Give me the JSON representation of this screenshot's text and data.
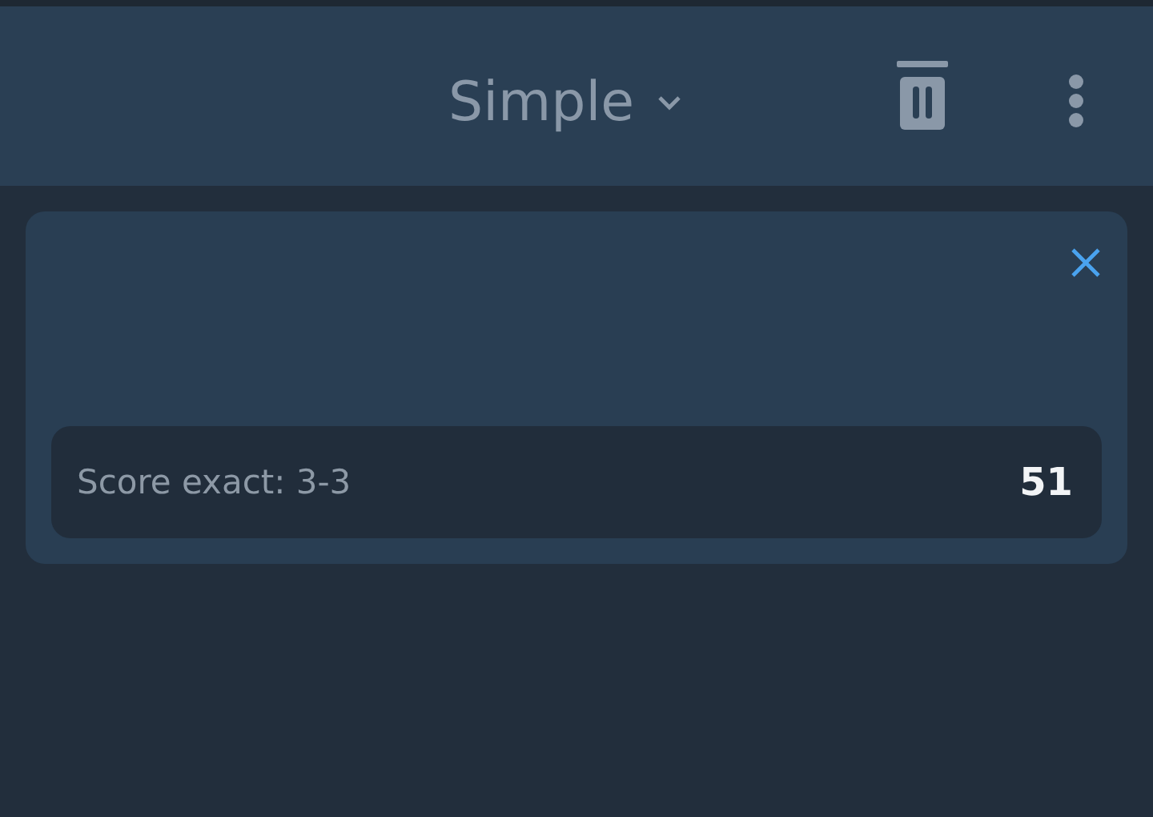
{
  "header": {
    "mode_selector": "Simple"
  },
  "card": {
    "selection": {
      "label": "Score exact: 3-3",
      "odds": "51"
    }
  }
}
